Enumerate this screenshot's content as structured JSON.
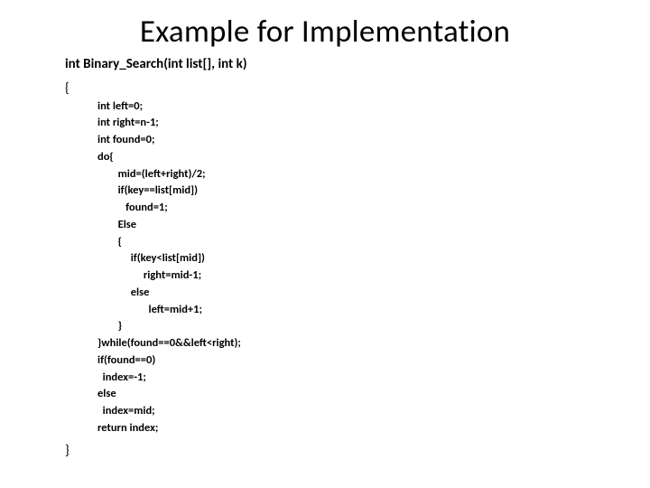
{
  "slide": {
    "title": "Example for Implementation",
    "signature": "int Binary_Search(int list[], int k)",
    "brace_open": "{",
    "brace_close": "}",
    "code": "int left=0;\nint right=n-1;\nint found=0;\ndo{\n        mid=(left+right)/2;\n        if(key==list[mid])\n           found=1;\n        Else\n        {\n             if(key<list[mid])\n                  right=mid-1;\n             else\n                    left=mid+1;\n        }\n}while(found==0&&left<right);\nif(found==0)\n  index=-1;\nelse\n  index=mid;\nreturn index;"
  }
}
